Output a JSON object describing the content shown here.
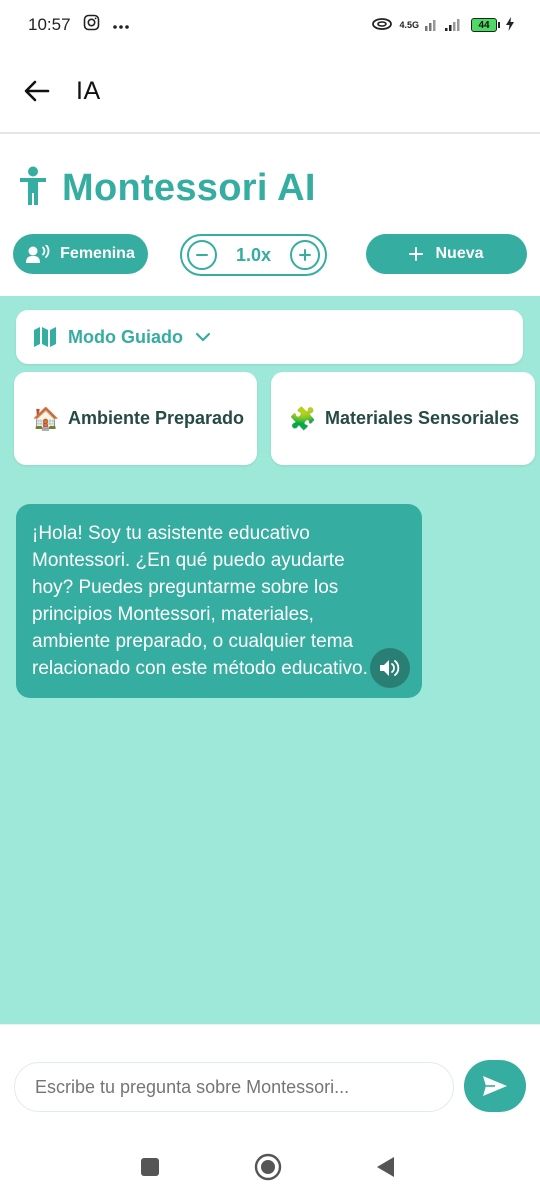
{
  "status": {
    "time": "10:57",
    "network": "4.5G",
    "battery": "44"
  },
  "appbar": {
    "title": "IA"
  },
  "brand": {
    "name": "Montessori AI",
    "accent_color": "#35ada0"
  },
  "controls": {
    "voice_label": "Femenina",
    "speed_value": "1.0x",
    "new_label": "Nueva"
  },
  "mode": {
    "label": "Modo Guiado"
  },
  "topics": [
    {
      "emoji": "🏠",
      "label": "Ambiente Preparado"
    },
    {
      "emoji": "🧩",
      "label": "Materiales Sensoriales"
    }
  ],
  "messages": [
    {
      "role": "assistant",
      "text": "¡Hola! Soy tu asistente educativo Montessori. ¿En qué puedo ayudarte hoy? Puedes preguntarme sobre los principios Montessori, materiales, ambiente preparado, o cualquier tema relacionado con este método educativo."
    }
  ],
  "composer": {
    "placeholder": "Escribe tu pregunta sobre Montessori..."
  },
  "colors": {
    "chat_background": "#9de8d8",
    "bubble": "#35ada0"
  }
}
